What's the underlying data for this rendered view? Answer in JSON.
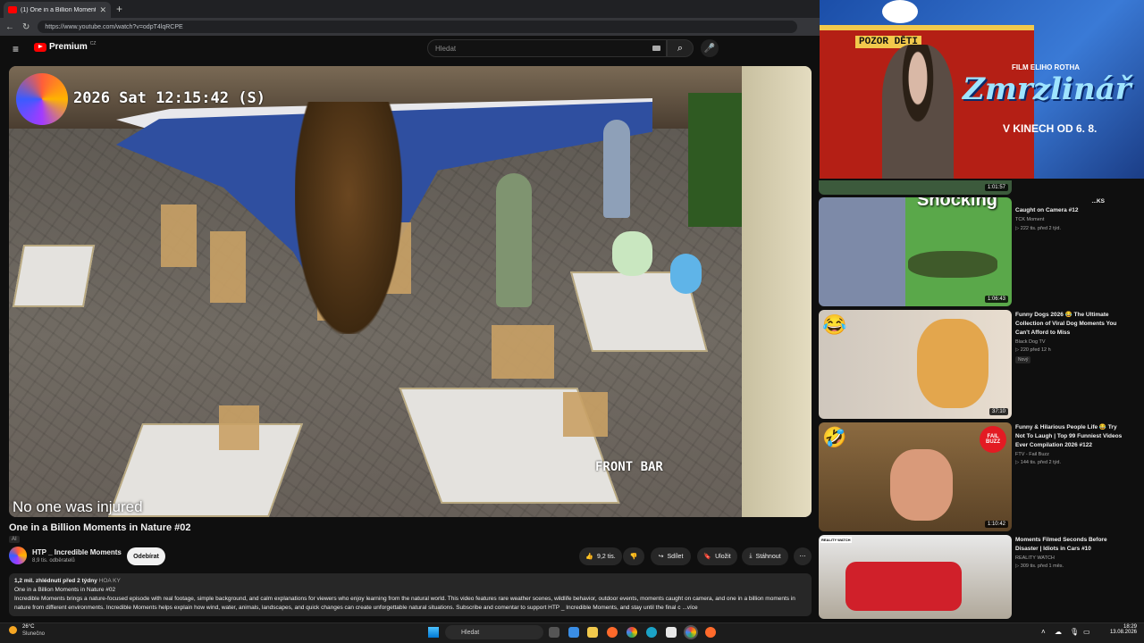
{
  "browser": {
    "tab_title": "(1) One in a Billion Moments",
    "tab_close": "✕",
    "new_tab": "+",
    "back": "←",
    "reload": "↻",
    "url": "https://www.youtube.com/watch?v=odpT4lqRCPE"
  },
  "header": {
    "menu": "≡",
    "logo": "Premium",
    "country": "CZ",
    "search_placeholder": "Hledat",
    "search_icon": "⌕",
    "mic_icon": "🎤"
  },
  "video": {
    "overlay_time": "2026 Sat 12:15:42 (S)",
    "camera_label": "FRONT BAR",
    "caption": "No one was injured"
  },
  "info": {
    "title": "One in a Billion Moments in Nature #02",
    "ai_badge": "AI",
    "channel": "HTP _ Incredible Moments",
    "subscribers": "8,9 tis. odběratelů",
    "subscribe": "Odebírat",
    "likes": "9,2 tis.",
    "share": "Sdílet",
    "save": "Uložit",
    "download": "Stáhnout",
    "more": "⋯",
    "views": "1,2 mil. zhlédnutí  před 2 týdny",
    "hashtag": "HOA KY",
    "desc_line1": "One in a Billion Moments in Nature #02",
    "desc_body": "Incredible Moments brings a nature-focused episode with real footage, simple background, and calm explanations for viewers who enjoy learning from the natural world. This video features rare weather scenes, wildlife behavior, outdoor events, moments caught on camera, and one in a billion moments in nature from different environments. Incredible Moments helps explain how wind, water, animals, landscapes, and quick changes can create unforgettable natural situations. Subscribe and comentar to support HTP _ Incredible Moments, and stay until the final c",
    "desc_more": "...více"
  },
  "ad": {
    "sign": "POZOR DĚTI",
    "small": "FILM ELIHO ROTHA",
    "title": "Zmrzlinář",
    "subtitle": "V KINECH OD 6. 8.",
    "colors": {
      "sky": "#2f6fd0",
      "bus": "#b41f15",
      "sign": "#f2c94c"
    }
  },
  "sidebar": {
    "top_duration": "1:01:57",
    "items": [
      {
        "title": "Caught on Camera #12",
        "title_partial": "...KS",
        "channel": "TCK Moment",
        "meta": "▷ 222 tis.  před 2 týd.",
        "duration": "1:06:43",
        "overlay_text": "Shocking"
      },
      {
        "title": "Funny Dogs 2026 😂 The Ultimate Collection of Viral Dog Moments You Can't Afford to Miss",
        "channel": "Black Dog TV",
        "meta": "▷ 220  před 12 h",
        "badge": "Nový",
        "duration": "37:10"
      },
      {
        "title": "Funny & Hilarious People Life 😂 Try Not To Laugh | Top 99 Funniest Videos Ever Compilation 2026 #122",
        "channel": "FTV - Fail Buzz",
        "meta": "▷ 144 tis.  před 2 týd.",
        "duration": "1:10:42",
        "thumb_badge": "FAIL BUZZ"
      },
      {
        "title": "Moments Filmed Seconds Before Disaster | Idiots in Cars #10",
        "channel": "REALITY WATCH",
        "meta": "▷ 309 tis.  před 1 měs.",
        "thumb_badge": "REALITY WATCH"
      }
    ]
  },
  "taskbar": {
    "temp": "26°C",
    "weather": "Slunečno",
    "search": "Hledat",
    "time": "18:29",
    "date": "13.08.2026"
  }
}
